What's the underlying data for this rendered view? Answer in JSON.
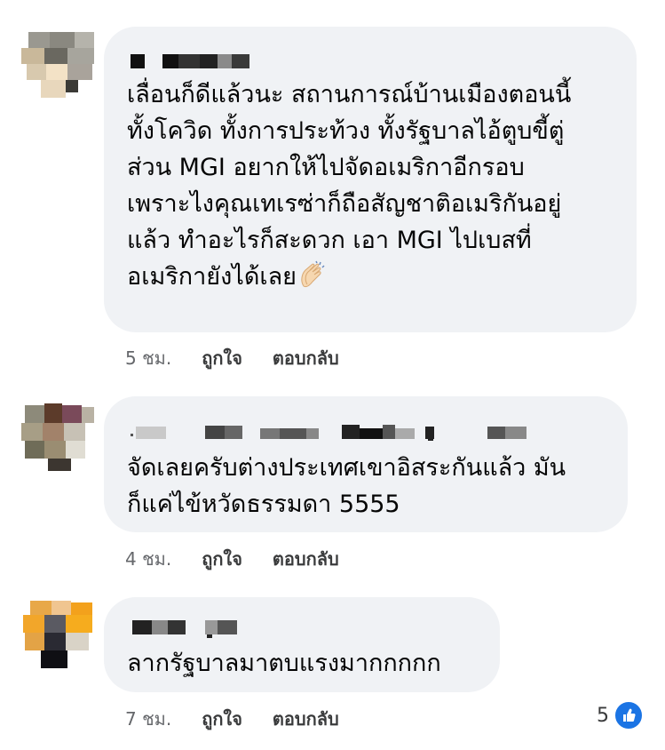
{
  "comments": [
    {
      "text": "เลื่อนก็ดีแล้วนะ สถานการณ์บ้านเมืองตอนนี้\nทั้งโควิด ทั้งการประท้วง ทั้งรัฐบาลไอ้ตูบขี้ตู่\nส่วน MGI อยากให้ไปจัดอเมริกาอีกรอบ\nเพราะไงคุณเทเรซ่าก็ถือสัญชาติอเมริกันอยู่\nแล้ว ทำอะไรก็สะดวก เอา MGI ไปเบสที่\nอเมริกายังได้เลย",
      "emoji": "clapping-hands",
      "time": "5 ชม.",
      "like_label": "ถูกใจ",
      "reply_label": "ตอบกลับ"
    },
    {
      "text": "จัดเลยครับต่างประเทศเขาอิสระกันแล้ว มัน\nก็แค่ไข้หวัดธรรมดา 5555",
      "time": "4 ชม.",
      "like_label": "ถูกใจ",
      "reply_label": "ตอบกลับ"
    },
    {
      "text": "ลากรัฐบาลมาตบแรงมากกกกก",
      "time": "7 ชม.",
      "like_label": "ถูกใจ",
      "reply_label": "ตอบกลับ",
      "reaction_count": "5",
      "reaction_icon": "thumbs-up-icon"
    }
  ],
  "colors": {
    "bubble": "#f0f2f5",
    "like_blue": "#1b74e4",
    "meta_text": "#65676b"
  }
}
